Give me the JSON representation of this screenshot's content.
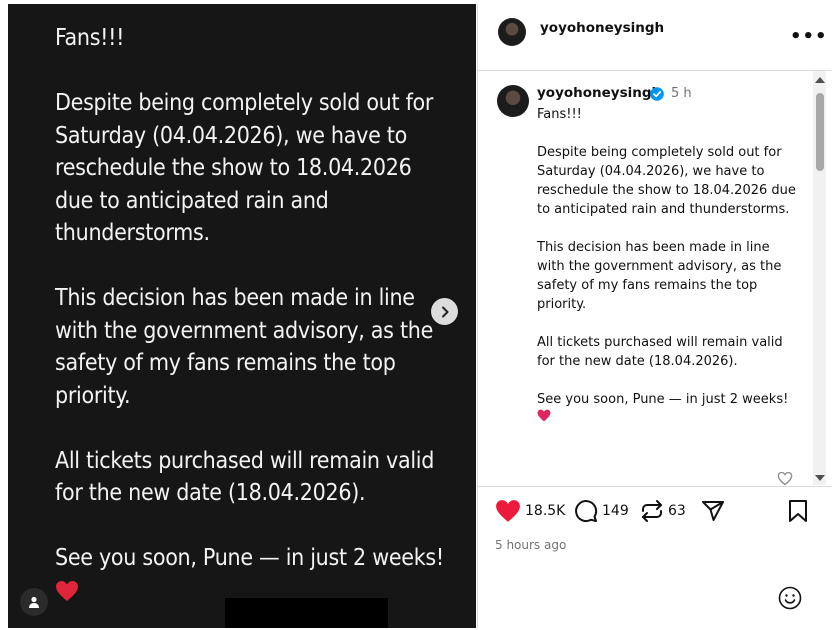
{
  "story": {
    "paragraphs": [
      "Fans!!!",
      "Despite being completely sold out for Saturday (04.04.2026), we have to reschedule the show to 18.04.2026 due to anticipated rain and thunderstorms.",
      "This decision has been made in line with the government advisory, as the safety of my fans remains the top priority.",
      "All tickets purchased will remain valid for the new date (18.04.2026).",
      "See you soon, Pune — in just 2 weeks!"
    ]
  },
  "header": {
    "username": "yoyohoneysingh",
    "more_label": "•••"
  },
  "caption": {
    "username": "yoyohoneysingh",
    "time": "5 h",
    "first_line": "Fans!!!",
    "paragraphs": [
      "Despite being completely sold out for Saturday (04.04.2026), we have to reschedule the show to 18.04.2026 due to anticipated rain and thunderstorms.",
      "This decision has been made in line with the government advisory, as the safety of my fans remains the top priority.",
      "All tickets purchased will remain valid for the new date (18.04.2026).",
      "See you soon, Pune — in just 2 weeks!"
    ]
  },
  "actions": {
    "likes": "18.5K",
    "comments": "149",
    "reposts": "63",
    "posted_ago": "5 hours ago"
  },
  "colors": {
    "like_red": "#ed1b3b",
    "verified_blue": "#0095f6",
    "emoji_heart": "#e0245e"
  }
}
